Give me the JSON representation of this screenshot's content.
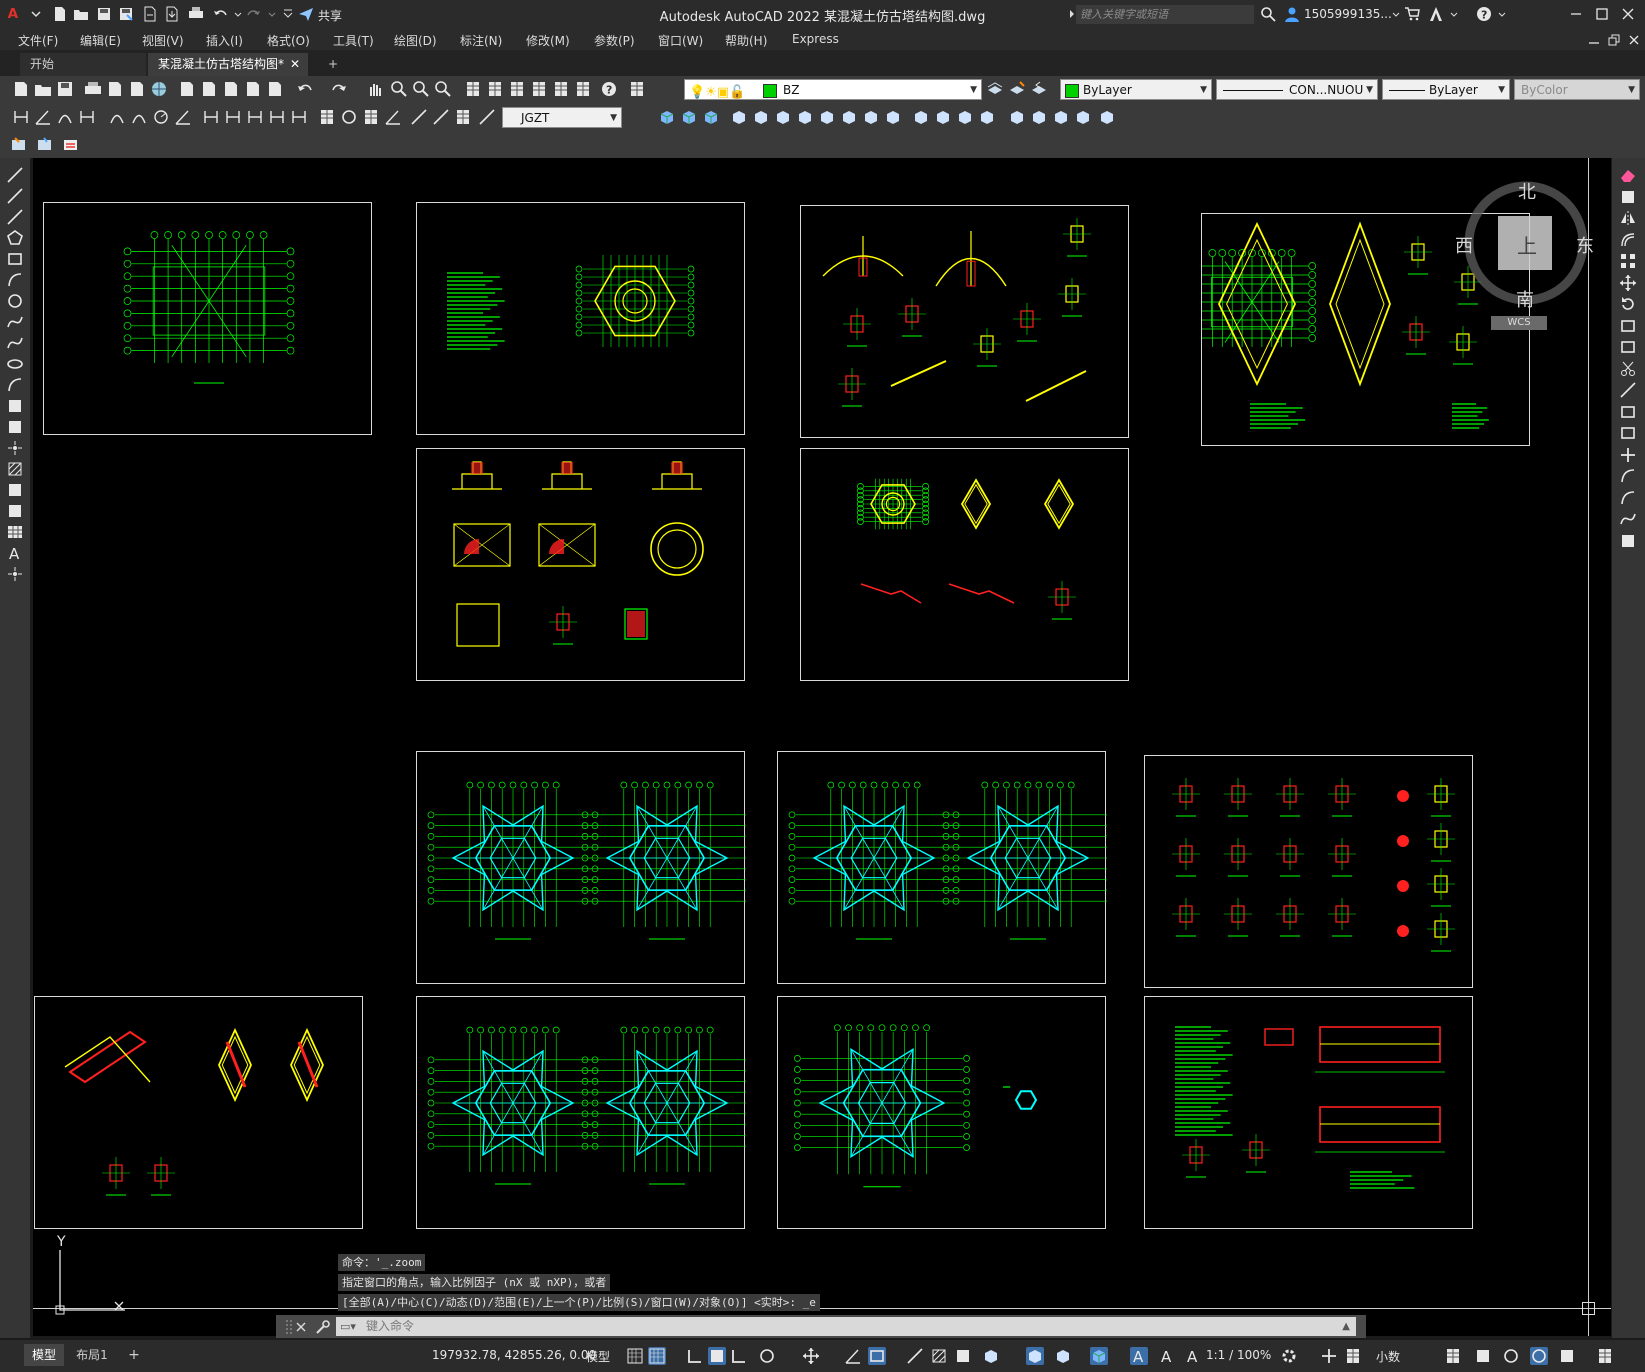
{
  "app": {
    "title": "Autodesk AutoCAD 2022    某混凝土仿古塔结构图.dwg",
    "share_label": "共享",
    "search_placeholder": "键入关键字或短语",
    "user": "1505999135...",
    "help": "?"
  },
  "menu": [
    "文件(F)",
    "编辑(E)",
    "视图(V)",
    "插入(I)",
    "格式(O)",
    "工具(T)",
    "绘图(D)",
    "标注(N)",
    "修改(M)",
    "参数(P)",
    "窗口(W)",
    "帮助(H)",
    "Express"
  ],
  "tabs": {
    "start": "开始",
    "active": "某混凝土仿古塔结构图*",
    "close": "✕",
    "add": "+"
  },
  "layer": {
    "name": "BZ",
    "color": "#00d000"
  },
  "properties": {
    "color": "ByLayer",
    "linetype": "CON...NUOU",
    "lineweight": "ByLayer",
    "plotstyle": "ByColor"
  },
  "dimstyle": "JGZT",
  "viewcube": {
    "north": "北",
    "south": "南",
    "east": "东",
    "west": "西",
    "top": "上",
    "wcs": "WCS"
  },
  "ucs": {
    "y": "Y"
  },
  "command": {
    "history": [
      "命令：'_.zoom",
      "指定窗口的角点，输入比例因子 (nX 或 nXP)，或者",
      "[全部(A)/中心(C)/动态(D)/范围(E)/上一个(P)/比例(S)/窗口(W)/对象(O)] <实时>: _e"
    ],
    "placeholder": "键入命令"
  },
  "layout_tabs": {
    "model": "模型",
    "layout1": "布局1",
    "add": "+"
  },
  "status": {
    "coords": "197932.78, 42855.26, 0.00",
    "space": "模型",
    "scale": "1:1 / 100%",
    "units": "小数"
  },
  "colors": {
    "bg": "#000000",
    "drawing_green": "#00ff00",
    "drawing_yellow": "#ffff00",
    "drawing_cyan": "#00ffff",
    "drawing_red": "#ff2020",
    "ui_dark": "#2b2b2b",
    "accent_blue": "#4aa3ff"
  }
}
